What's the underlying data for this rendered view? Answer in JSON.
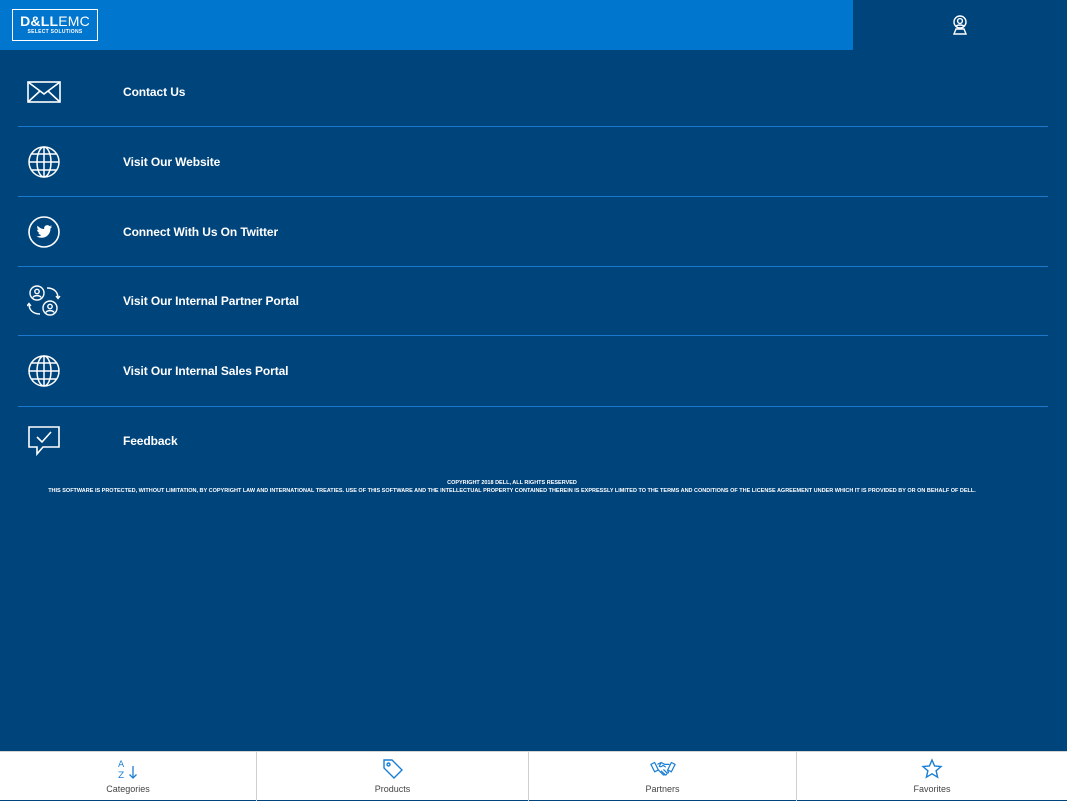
{
  "header": {
    "logo_brand_bold": "D&LL",
    "logo_brand_light": "EMC",
    "logo_sub": "SELECT SOLUTIONS",
    "profile_icon": "user-badge-icon"
  },
  "menu": {
    "items": [
      {
        "label": "Contact Us",
        "icon": "envelope-icon"
      },
      {
        "label": "Visit Our Website",
        "icon": "globe-icon"
      },
      {
        "label": "Connect With Us On Twitter",
        "icon": "twitter-icon"
      },
      {
        "label": "Visit Our Internal Partner Portal",
        "icon": "partner-exchange-icon"
      },
      {
        "label": "Visit Our Internal Sales Portal",
        "icon": "globe-icon"
      },
      {
        "label": "Feedback",
        "icon": "feedback-chat-icon"
      }
    ]
  },
  "footer": {
    "copyright_line1": "COPYRIGHT 2018 DELL, ALL RIGHTS RESERVED",
    "copyright_line2": "THIS SOFTWARE IS PROTECTED, WITHOUT LIMITATION, BY COPYRIGHT LAW AND INTERNATIONAL TREATIES. USE OF THIS SOFTWARE AND THE INTELLECTUAL PROPERTY CONTAINED THEREIN IS EXPRESSLY LIMITED TO THE TERMS AND CONDITIONS OF THE LICENSE AGREEMENT UNDER WHICH IT IS PROVIDED BY OR ON BEHALF OF DELL."
  },
  "tabs": [
    {
      "label": "Categories",
      "icon": "sort-az-icon"
    },
    {
      "label": "Products",
      "icon": "tag-icon"
    },
    {
      "label": "Partners",
      "icon": "handshake-icon"
    },
    {
      "label": "Favorites",
      "icon": "star-icon"
    }
  ],
  "colors": {
    "background": "#00447c",
    "header_accent": "#0076ce",
    "divider": "#1c78cc",
    "tab_icon": "#1a7fd4"
  }
}
